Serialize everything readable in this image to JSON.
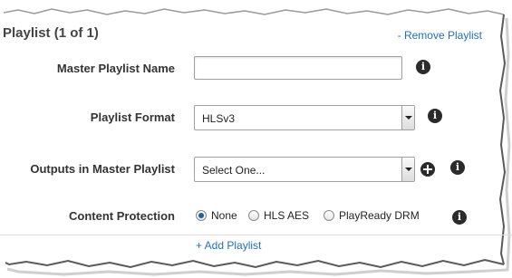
{
  "panel": {
    "title": "Playlist (1 of 1)",
    "remove_link": "- Remove Playlist",
    "add_link": "+ Add Playlist"
  },
  "fields": {
    "master_playlist_name": {
      "label": "Master Playlist Name",
      "value": "",
      "placeholder": ""
    },
    "playlist_format": {
      "label": "Playlist Format",
      "selected": "HLSv3"
    },
    "outputs": {
      "label": "Outputs in Master Playlist",
      "selected": "Select One..."
    },
    "content_protection": {
      "label": "Content Protection",
      "options": [
        "None",
        "HLS AES",
        "PlayReady DRM"
      ],
      "selected": "None"
    }
  },
  "icons": {
    "info": "info-icon",
    "add": "add-circle-icon"
  },
  "colors": {
    "link": "#1f6fc5",
    "icon": "#2b2b2b",
    "radio_selected": "#1d5fa8"
  }
}
